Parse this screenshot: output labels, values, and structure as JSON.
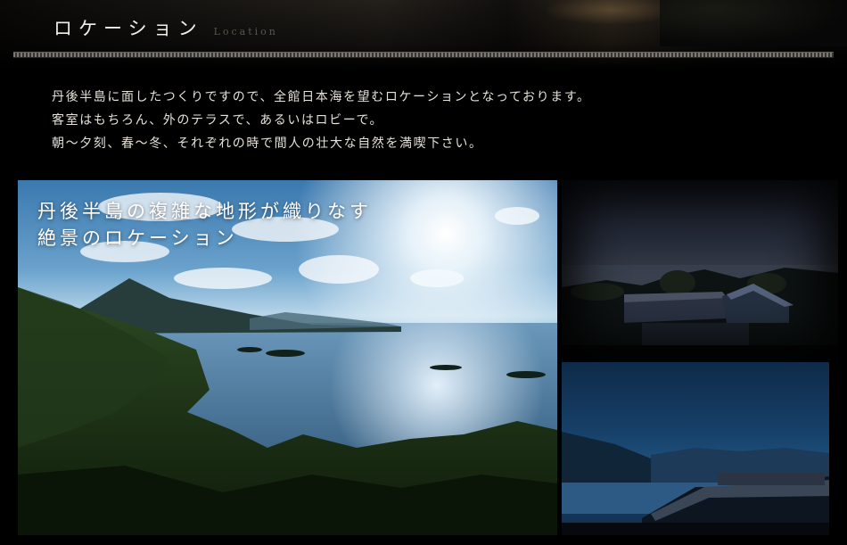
{
  "header": {
    "title_jp": "ロケーション",
    "title_en": "Location"
  },
  "intro": {
    "lines": [
      "丹後半島に面したつくりですので、全館日本海を望むロケーションとなっております。",
      "客室はもちろん、外のテラスで、あるいはロビーで。",
      "朝～夕刻、春～冬、それぞれの時で間人の壮大な自然を満喫下さい。"
    ]
  },
  "main_photo": {
    "caption_lines": [
      "丹後半島の複雑な地形が織りなす",
      "絶景のロケーション"
    ]
  },
  "colors": {
    "background": "#000000",
    "text": "#e6e2da",
    "subtitle": "#5a564e"
  }
}
